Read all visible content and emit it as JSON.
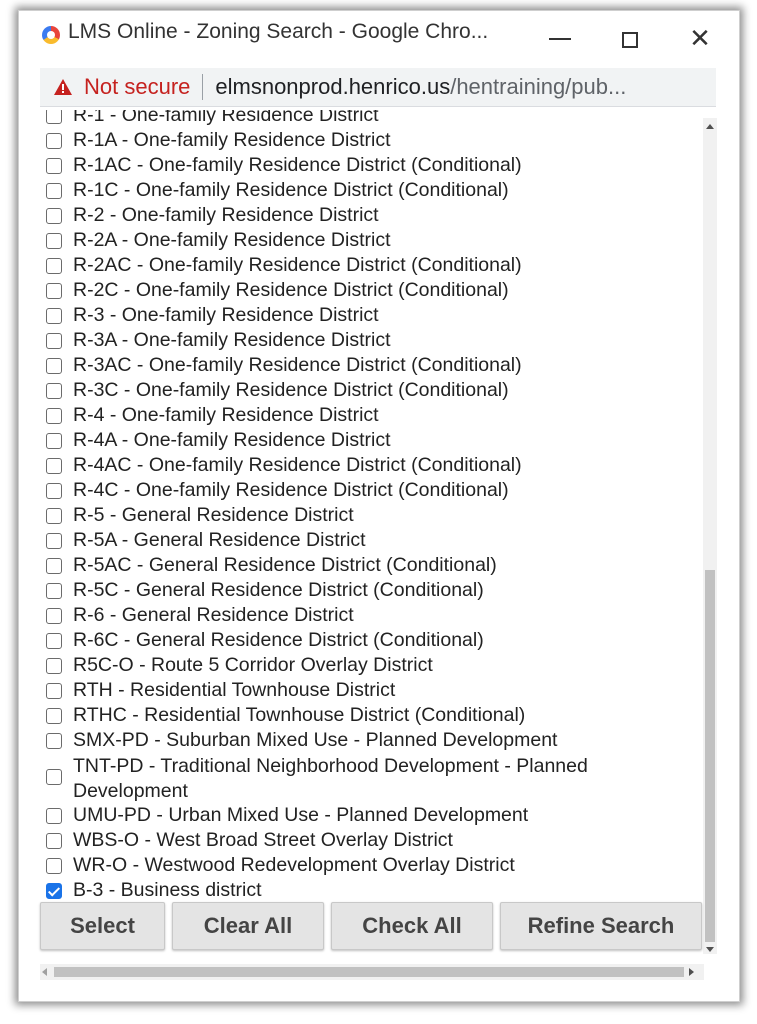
{
  "window": {
    "title": "LMS Online - Zoning Search - Google Chro...",
    "minimize_icon": "minimize-icon",
    "maximize_icon": "maximize-icon",
    "close_icon": "close-icon"
  },
  "address": {
    "security_label": "Not secure",
    "host": "elmsnonprod.henrico.us",
    "path": "/hentraining/pub...",
    "warning_color": "#c5221f"
  },
  "options": [
    {
      "label": "R-1 - One-family Residence District",
      "checked": false
    },
    {
      "label": "R-1A - One-family Residence District",
      "checked": false
    },
    {
      "label": "R-1AC - One-family Residence District (Conditional)",
      "checked": false
    },
    {
      "label": "R-1C - One-family Residence District (Conditional)",
      "checked": false
    },
    {
      "label": "R-2 - One-family Residence District",
      "checked": false
    },
    {
      "label": "R-2A - One-family Residence District",
      "checked": false
    },
    {
      "label": "R-2AC - One-family Residence District (Conditional)",
      "checked": false
    },
    {
      "label": "R-2C - One-family Residence District (Conditional)",
      "checked": false
    },
    {
      "label": "R-3 - One-family Residence District",
      "checked": false
    },
    {
      "label": "R-3A - One-family Residence District",
      "checked": false
    },
    {
      "label": "R-3AC - One-family Residence District (Conditional)",
      "checked": false
    },
    {
      "label": "R-3C - One-family Residence District (Conditional)",
      "checked": false
    },
    {
      "label": "R-4 - One-family Residence District",
      "checked": false
    },
    {
      "label": "R-4A - One-family Residence District",
      "checked": false
    },
    {
      "label": "R-4AC - One-family Residence District (Conditional)",
      "checked": false
    },
    {
      "label": "R-4C - One-family Residence District (Conditional)",
      "checked": false
    },
    {
      "label": "R-5 - General Residence District",
      "checked": false
    },
    {
      "label": "R-5A - General Residence District",
      "checked": false
    },
    {
      "label": "R-5AC - General Residence District (Conditional)",
      "checked": false
    },
    {
      "label": "R-5C - General Residence District (Conditional)",
      "checked": false
    },
    {
      "label": "R-6 - General Residence District",
      "checked": false
    },
    {
      "label": "R-6C - General Residence District (Conditional)",
      "checked": false
    },
    {
      "label": "R5C-O - Route 5 Corridor Overlay District",
      "checked": false
    },
    {
      "label": "RTH - Residential Townhouse District",
      "checked": false
    },
    {
      "label": "RTHC - Residential Townhouse District (Conditional)",
      "checked": false
    },
    {
      "label": "SMX-PD - Suburban Mixed Use - Planned Development",
      "checked": false
    },
    {
      "label": "TNT-PD - Traditional Neighborhood Development - Planned Development",
      "checked": false,
      "wrap": true
    },
    {
      "label": "UMU-PD - Urban Mixed Use - Planned Development",
      "checked": false
    },
    {
      "label": "WBS-O - West Broad Street Overlay District",
      "checked": false
    },
    {
      "label": "WR-O - Westwood Redevelopment Overlay District",
      "checked": false
    },
    {
      "label": "B-3 - Business district",
      "checked": true
    }
  ],
  "buttons": {
    "select": "Select",
    "clear_all": "Clear All",
    "check_all": "Check All",
    "refine_search": "Refine Search"
  },
  "colors": {
    "checkbox_checked": "#1a73e8",
    "button_bg": "#e4e4e4"
  }
}
